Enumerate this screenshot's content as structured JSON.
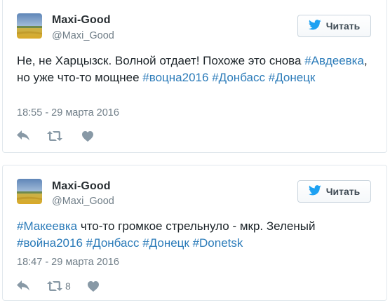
{
  "tweets": [
    {
      "name": "Maxi-Good",
      "handle": "@Maxi_Good",
      "follow_label": "Читать",
      "text_segments": [
        {
          "t": "Не, не Харцызск. Волной отдает! Похоже это снова ",
          "tag": false
        },
        {
          "t": "#Авдеевка",
          "tag": true
        },
        {
          "t": ", но уже что-то мощнее ",
          "tag": false
        },
        {
          "t": "#воцна2016",
          "tag": true
        },
        {
          "t": " ",
          "tag": false
        },
        {
          "t": "#Донбасс",
          "tag": true
        },
        {
          "t": " ",
          "tag": false
        },
        {
          "t": "#Донецк",
          "tag": true
        }
      ],
      "timestamp": "18:55 - 29 марта 2016",
      "actions": {
        "reply_icon": "reply-icon",
        "retweet_icon": "retweet-icon",
        "like_icon": "heart-icon",
        "retweet_count": ""
      }
    },
    {
      "name": "Maxi-Good",
      "handle": "@Maxi_Good",
      "follow_label": "Читать",
      "text_segments": [
        {
          "t": "#Макеевка",
          "tag": true
        },
        {
          "t": " что-то громкое стрельнуло - мкр. Зеленый ",
          "tag": false
        },
        {
          "t": "#война2016",
          "tag": true
        },
        {
          "t": " ",
          "tag": false
        },
        {
          "t": "#Донбасс",
          "tag": true
        },
        {
          "t": " ",
          "tag": false
        },
        {
          "t": "#Донецк",
          "tag": true
        },
        {
          "t": " ",
          "tag": false
        },
        {
          "t": "#Donetsk",
          "tag": true
        }
      ],
      "timestamp": "18:47 - 29 марта 2016",
      "actions": {
        "reply_icon": "reply-icon",
        "retweet_icon": "retweet-icon",
        "like_icon": "heart-icon",
        "retweet_count": "8"
      }
    }
  ],
  "colors": {
    "hashtag": "#2b7bb9",
    "twitter_bird": "#1da1f2",
    "muted": "#8899a6"
  }
}
